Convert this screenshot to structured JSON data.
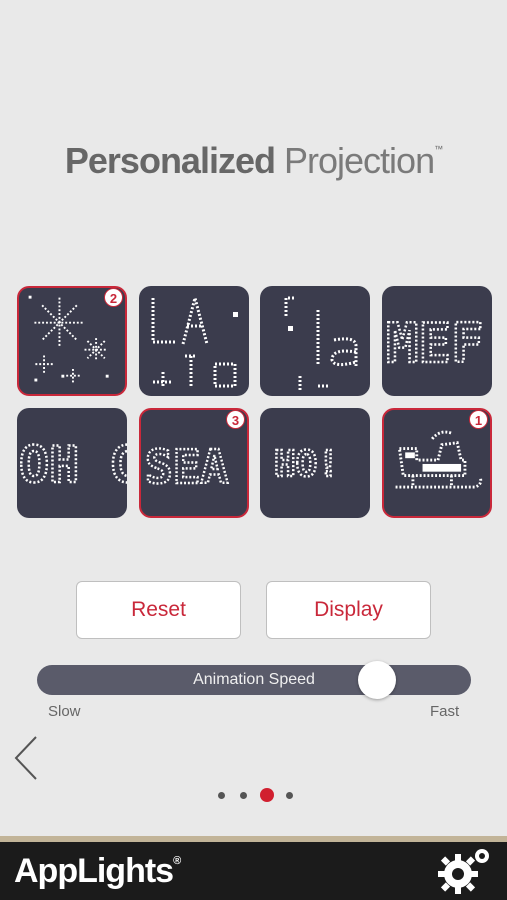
{
  "header": {
    "title_bold": "Personalized",
    "title_light": "Projection",
    "trademark": "™"
  },
  "tiles": [
    {
      "name": "snowflakes",
      "selected": true,
      "badge": "2"
    },
    {
      "name": "la-la",
      "selected": false,
      "badge": ""
    },
    {
      "name": "music-la",
      "selected": false,
      "badge": ""
    },
    {
      "name": "merry",
      "selected": false,
      "badge": "",
      "text": "MEF"
    },
    {
      "name": "oh-christmas",
      "selected": false,
      "badge": "",
      "text": "OH C"
    },
    {
      "name": "season",
      "selected": true,
      "badge": "3",
      "text": "SEA"
    },
    {
      "name": "ho-ho",
      "selected": false,
      "badge": "",
      "text": "HO!"
    },
    {
      "name": "sleigh",
      "selected": true,
      "badge": "1"
    }
  ],
  "buttons": {
    "reset": "Reset",
    "display": "Display"
  },
  "slider": {
    "label": "Animation Speed",
    "min_label": "Slow",
    "max_label": "Fast",
    "value": 0.78
  },
  "pager": {
    "count": 4,
    "active": 2
  },
  "footer": {
    "brand": "AppLights",
    "registered": "®"
  },
  "colors": {
    "accent": "#c9283a",
    "tile_bg": "#3b3c4d",
    "page_bg": "#e9e9e9"
  },
  "icons": {
    "back": "chevron-left-icon",
    "settings": "gear-icon"
  }
}
